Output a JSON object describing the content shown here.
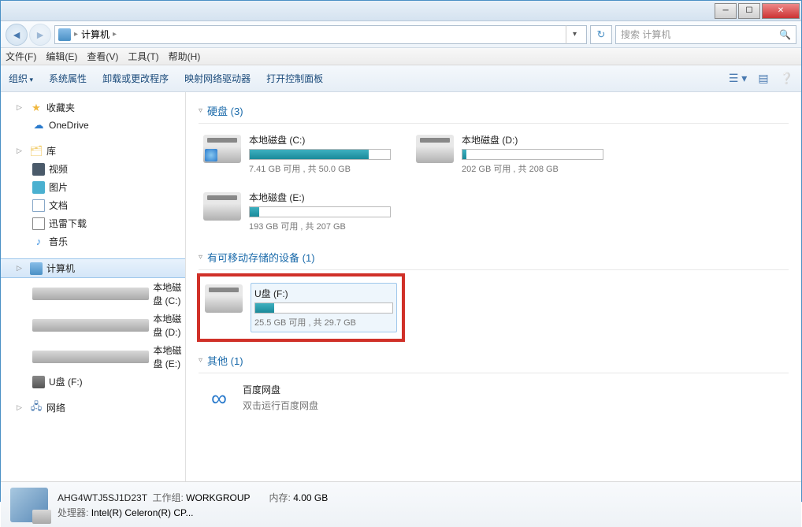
{
  "breadcrumb": {
    "path": "计算机",
    "sep": "▸"
  },
  "search": {
    "placeholder": "搜索 计算机"
  },
  "menu": {
    "file": "文件(F)",
    "edit": "编辑(E)",
    "view": "查看(V)",
    "tools": "工具(T)",
    "help": "帮助(H)"
  },
  "toolbar": {
    "organize": "组织",
    "sysprops": "系统属性",
    "uninstall": "卸载或更改程序",
    "mapnet": "映射网络驱动器",
    "controlpanel": "打开控制面板"
  },
  "sidebar": {
    "favorites": "收藏夹",
    "onedrive": "OneDrive",
    "libraries": "库",
    "videos": "视频",
    "pictures": "图片",
    "documents": "文档",
    "downloads": "迅雷下载",
    "music": "音乐",
    "computer": "计算机",
    "drive_c": "本地磁盘 (C:)",
    "drive_d": "本地磁盘 (D:)",
    "drive_e": "本地磁盘 (E:)",
    "drive_f": "U盘 (F:)",
    "network": "网络"
  },
  "groups": {
    "hdd": "硬盘 (3)",
    "removable": "有可移动存储的设备 (1)",
    "other": "其他 (1)"
  },
  "drives": {
    "c": {
      "name": "本地磁盘 (C:)",
      "info": "7.41 GB 可用 , 共 50.0 GB",
      "fill": 85
    },
    "d": {
      "name": "本地磁盘 (D:)",
      "info": "202 GB 可用 , 共 208 GB",
      "fill": 3
    },
    "e": {
      "name": "本地磁盘 (E:)",
      "info": "193 GB 可用 , 共 207 GB",
      "fill": 7
    },
    "f": {
      "name": "U盘 (F:)",
      "info": "25.5 GB 可用 , 共 29.7 GB",
      "fill": 14
    }
  },
  "other": {
    "baidu": {
      "name": "百度网盘",
      "sub": "双击运行百度网盘"
    }
  },
  "status": {
    "name": "AHG4WTJ5SJ1D23T",
    "workgroup_lbl": "工作组:",
    "workgroup": "WORKGROUP",
    "cpu_lbl": "处理器:",
    "cpu": "Intel(R) Celeron(R) CP...",
    "mem_lbl": "内存:",
    "mem": "4.00 GB"
  }
}
